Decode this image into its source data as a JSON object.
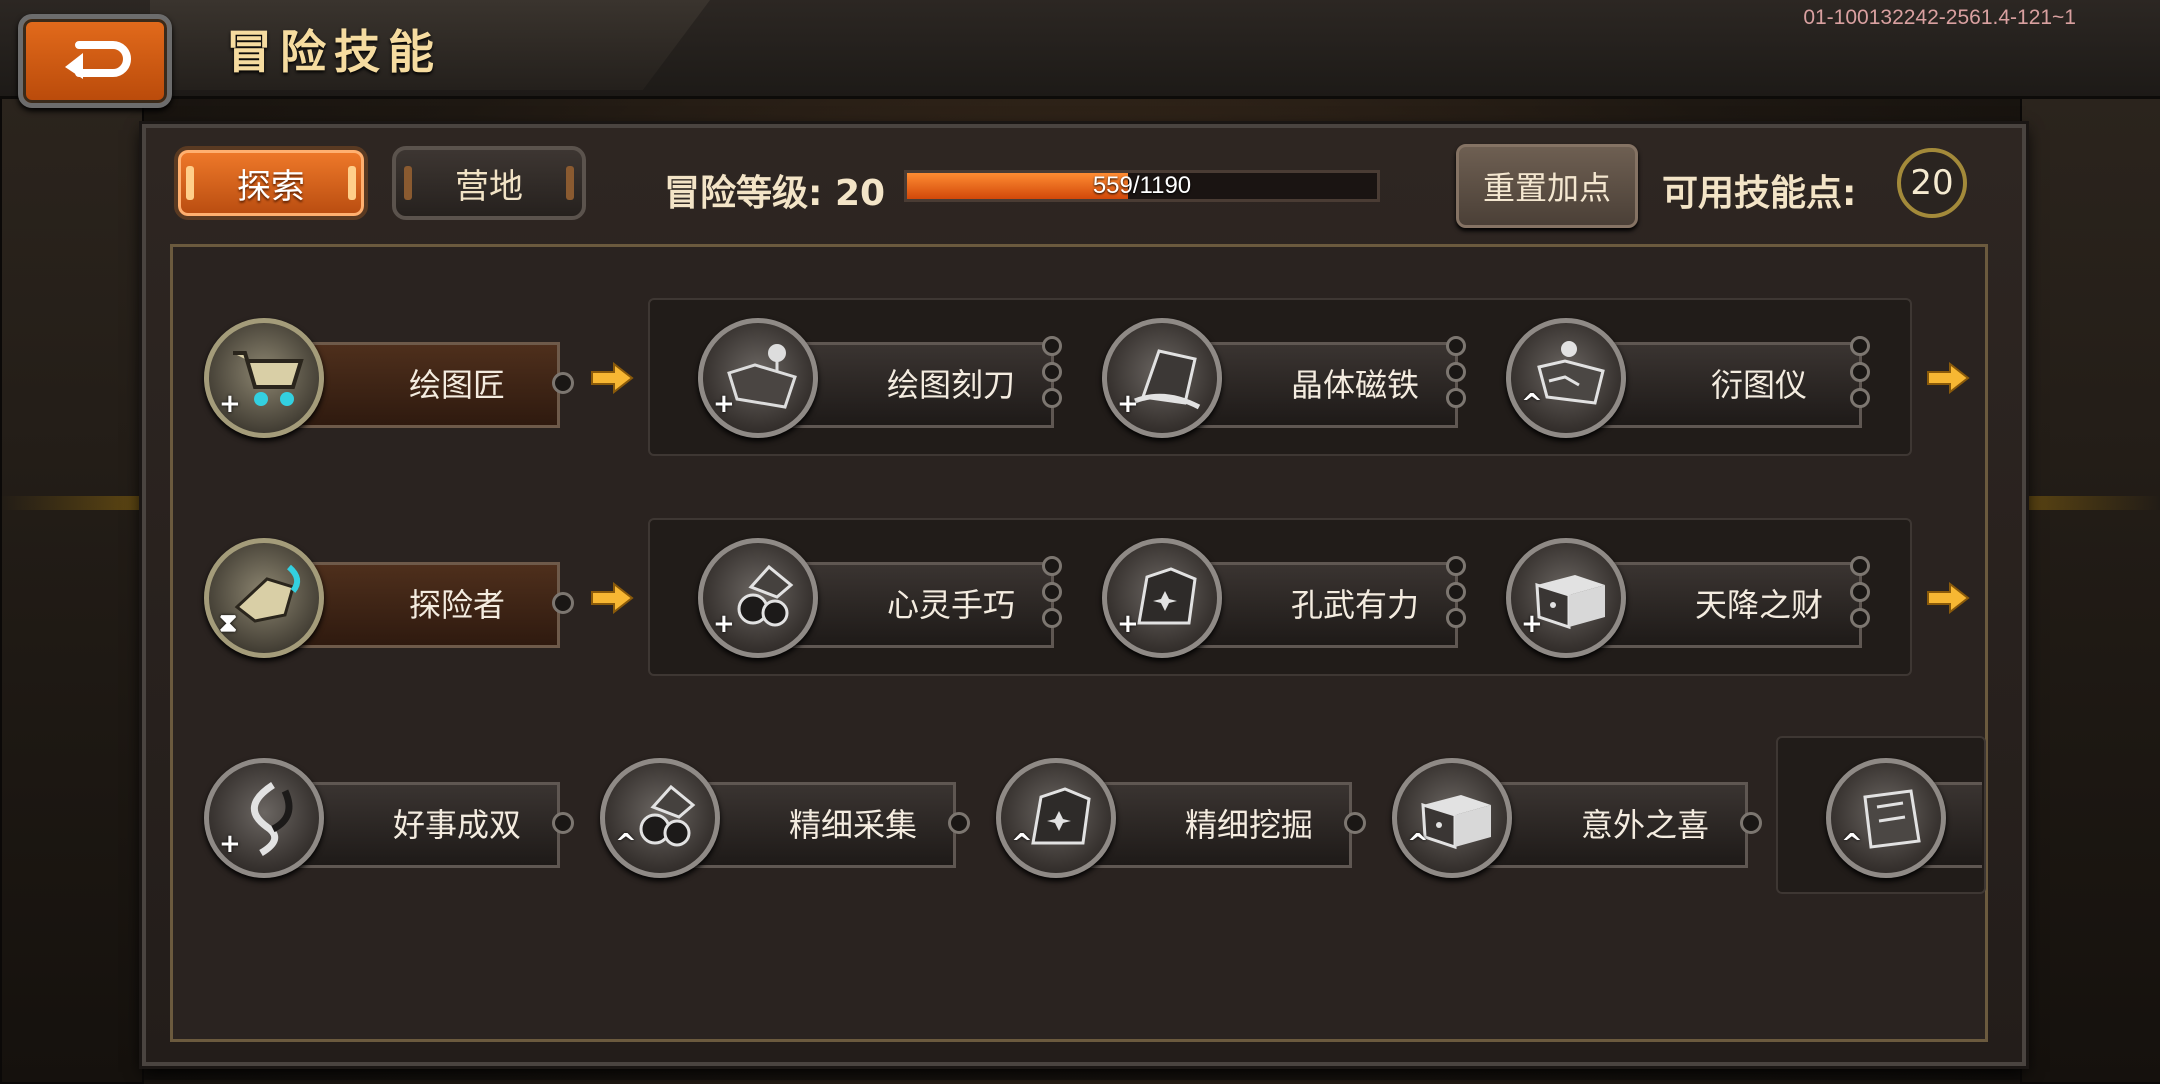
{
  "header": {
    "title": "冒险技能",
    "version": "01-100132242-2561.4-121~1"
  },
  "tabs": [
    {
      "label": "探索",
      "active": true
    },
    {
      "label": "营地",
      "active": false
    }
  ],
  "level": {
    "label": "冒险等级:",
    "value": "20",
    "progress_text": "559/1190",
    "progress_fraction": 0.47
  },
  "reset_label": "重置加点",
  "points": {
    "label": "可用技能点:",
    "value": "20"
  },
  "rows": [
    {
      "main": {
        "name": "绘图匠",
        "icon": "cart-icon",
        "mark": "+"
      },
      "children": [
        {
          "name": "绘图刻刀",
          "icon": "map-pin-icon",
          "mark": "+"
        },
        {
          "name": "晶体磁铁",
          "icon": "crystal-icon",
          "mark": "+"
        },
        {
          "name": "衍图仪",
          "icon": "map-scroll-icon",
          "mark": "^"
        }
      ]
    },
    {
      "main": {
        "name": "探险者",
        "icon": "glove-icon",
        "mark": "⧗"
      },
      "children": [
        {
          "name": "心灵手巧",
          "icon": "gem-cluster-icon",
          "mark": "+"
        },
        {
          "name": "孔武有力",
          "icon": "rock-icon",
          "mark": "+"
        },
        {
          "name": "天降之财",
          "icon": "treasure-chest-icon",
          "mark": "+"
        }
      ]
    },
    {
      "items": [
        {
          "name": "好事成双",
          "icon": "twin-swirl-icon",
          "mark": "+"
        },
        {
          "name": "精细采集",
          "icon": "gem-cluster-icon",
          "mark": "^"
        },
        {
          "name": "精细挖掘",
          "icon": "rock-icon",
          "mark": "^"
        },
        {
          "name": "意外之喜",
          "icon": "treasure-chest-icon",
          "mark": "^"
        },
        {
          "name": "",
          "icon": "scroll-map-icon",
          "mark": "^"
        }
      ]
    }
  ],
  "colors": {
    "accent_orange": "#e36b1c",
    "title_gold": "#f6dca0",
    "arrow_yellow": "#f7b733"
  }
}
